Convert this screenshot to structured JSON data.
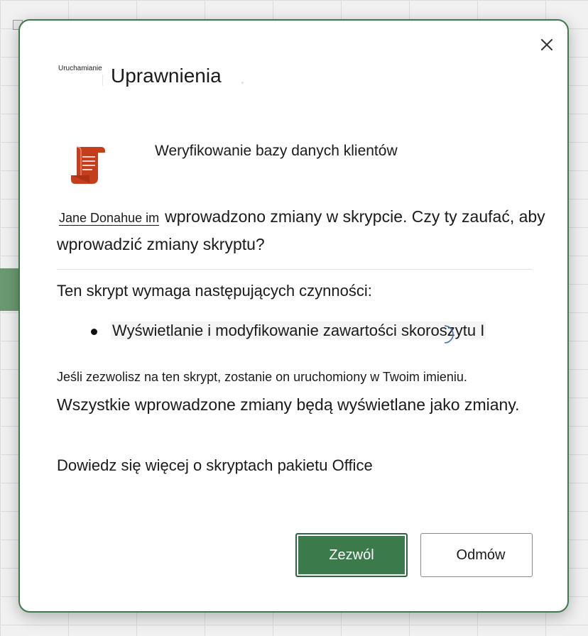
{
  "dialog": {
    "small_label": "Uruchamianie",
    "title": "Uprawnienia",
    "script_name": "Weryfikowanie bazy danych klientów",
    "author": "Jane Donahue im",
    "intro_text": "wprowadzono zmiany w skrypcie. Czy ty zaufać, aby wprowadzić zmiany skryptu?",
    "requires_heading": "Ten skrypt wymaga następujących czynności:",
    "permissions": [
      "Wyświetlanie i modyfikowanie zawartości skoroszytu I"
    ],
    "note_small": "Jeśli zezwolisz na ten skrypt, zostanie on uruchomiony w Twoim imieniu.",
    "note_large": "Wszystkie wprowadzone zmiany będą wyświetlane jako zmiany.",
    "learn_more": "Dowiedz się więcej o skryptach pakietu Office",
    "allow_label": "Zezwól",
    "deny_label": "Odmów"
  },
  "icons": {
    "close": "close-icon",
    "script": "script-scroll-icon"
  },
  "colors": {
    "accent": "#3b7a4b",
    "script_icon": "#c43e1c",
    "background_cell": "#6b9a72"
  }
}
